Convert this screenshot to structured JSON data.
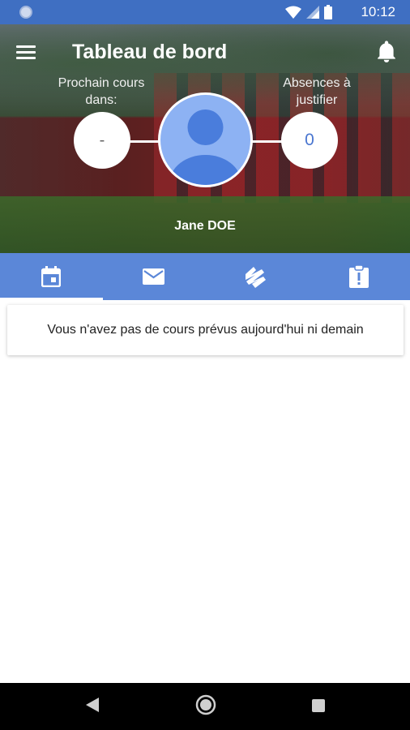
{
  "status_bar": {
    "time": "10:12"
  },
  "header": {
    "title": "Tableau de bord",
    "next_class_label": "Prochain cours\ndans:",
    "next_class_value": "-",
    "absences_label": "Absences à\njustifier",
    "absences_value": "0",
    "user_name": "Jane DOE"
  },
  "tabs": [
    {
      "icon": "calendar-icon",
      "active": true
    },
    {
      "icon": "mail-icon",
      "active": false
    },
    {
      "icon": "grades-icon",
      "active": false
    },
    {
      "icon": "clipboard-alert-icon",
      "active": false
    }
  ],
  "main": {
    "empty_message": "Vous n'avez pas de cours prévus aujourd'hui ni demain"
  },
  "colors": {
    "status_bar": "#3f6fc2",
    "tabs_bg": "#5b87d8",
    "avatar_bg": "#8db2f3",
    "accent": "#4a76d0"
  }
}
